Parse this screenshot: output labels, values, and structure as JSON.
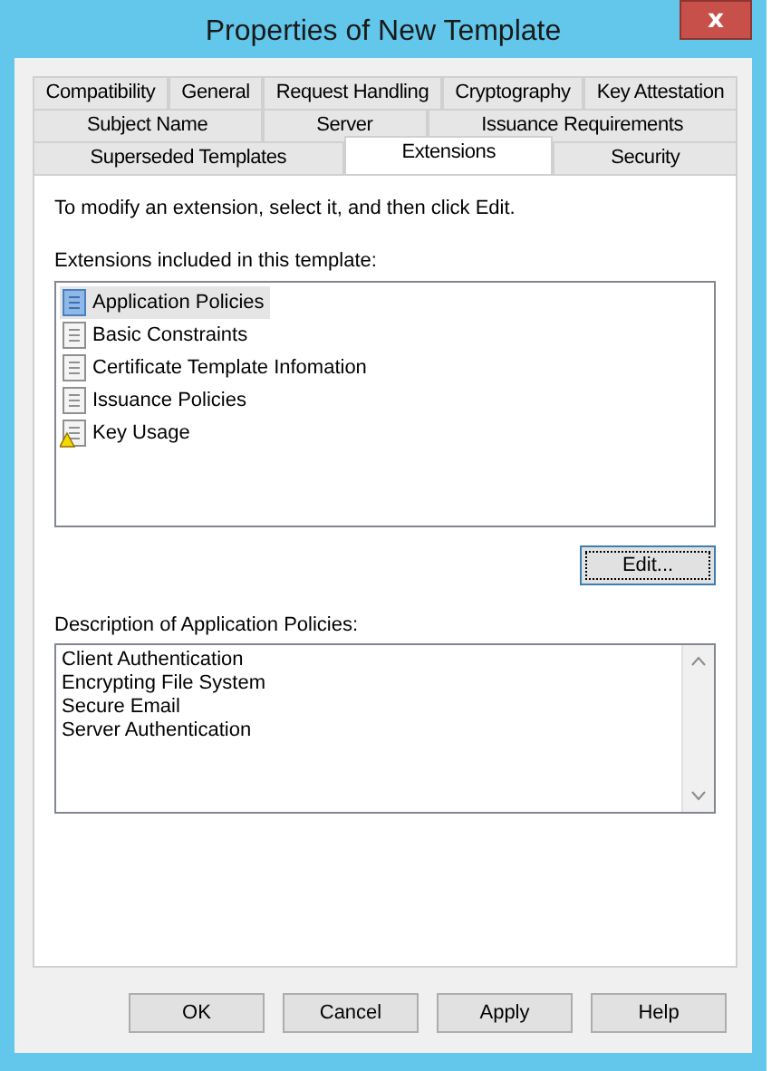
{
  "window": {
    "title": "Properties of New Template",
    "close": "x"
  },
  "tab_rows": [
    [
      {
        "label": "Compatibility",
        "selected": false
      },
      {
        "label": "General",
        "selected": false
      },
      {
        "label": "Request Handling",
        "selected": false
      },
      {
        "label": "Cryptography",
        "selected": false
      },
      {
        "label": "Key Attestation",
        "selected": false
      }
    ],
    [
      {
        "label": "Subject Name",
        "selected": false
      },
      {
        "label": "Server",
        "selected": false
      },
      {
        "label": "Issuance Requirements",
        "selected": false
      }
    ],
    [
      {
        "label": "Superseded Templates",
        "selected": false
      },
      {
        "label": "Extensions",
        "selected": true
      },
      {
        "label": "Security",
        "selected": false
      }
    ]
  ],
  "instruction": "To modify an extension, select it, and then click Edit.",
  "extensions_label": "Extensions included in this template:",
  "extensions": [
    {
      "label": "Application Policies",
      "kind": "document",
      "selected": true
    },
    {
      "label": "Basic Constraints",
      "kind": "document",
      "selected": false
    },
    {
      "label": "Certificate Template Infomation",
      "kind": "document",
      "selected": false
    },
    {
      "label": "Issuance Policies",
      "kind": "document",
      "selected": false
    },
    {
      "label": "Key Usage",
      "kind": "warning",
      "selected": false
    }
  ],
  "edit_button": "Edit...",
  "description_label": "Description of Application Policies:",
  "description_lines": [
    "Client Authentication",
    "Encrypting File System",
    "Secure Email",
    "Server Authentication"
  ],
  "buttons": [
    "OK",
    "Cancel",
    "Apply",
    "Help"
  ]
}
